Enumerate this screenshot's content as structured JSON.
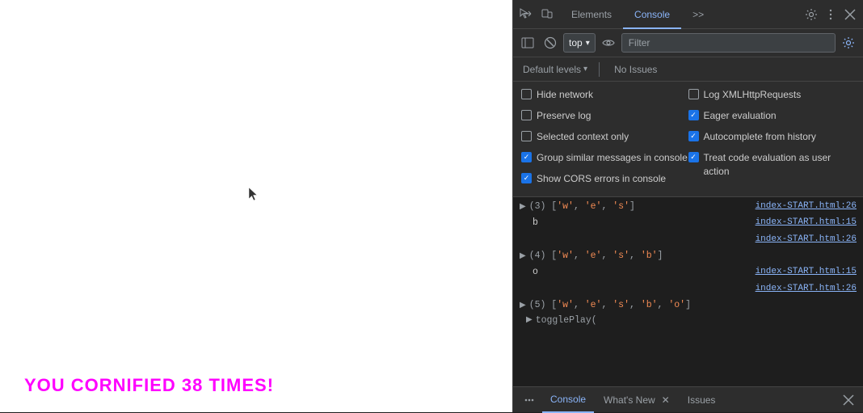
{
  "webpage": {
    "cornified_text": "YOU CORNIFIED 38 TIMES!"
  },
  "devtools": {
    "tabs": [
      {
        "label": "Elements",
        "active": false
      },
      {
        "label": "Console",
        "active": true
      },
      {
        "label": ">>",
        "active": false
      }
    ],
    "top_icons": {
      "cursor_icon": "cursor-icon",
      "device_icon": "device-icon",
      "gear_icon": "gear-icon",
      "more_icon": "more-icon",
      "close_icon": "close-icon"
    },
    "header": {
      "sidebar_icon": "sidebar-icon",
      "clear_icon": "clear-icon",
      "context_label": "top",
      "context_arrow": "▾",
      "eye_icon": "eye-icon",
      "filter_placeholder": "Filter",
      "settings_icon": "settings-icon"
    },
    "subbar": {
      "levels_label": "Default levels",
      "levels_arrow": "▾",
      "no_issues": "No Issues"
    },
    "settings": {
      "col1": [
        {
          "label": "Hide network",
          "checked": false
        },
        {
          "label": "Preserve log",
          "checked": false
        },
        {
          "label": "Selected context only",
          "checked": false
        },
        {
          "label": "Group similar messages in console",
          "checked": true
        },
        {
          "label": "Show CORS errors in console",
          "checked": true
        }
      ],
      "col2": [
        {
          "label": "Log XMLHttpRequests",
          "checked": false
        },
        {
          "label": "Eager evaluation",
          "checked": true
        },
        {
          "label": "Autocomplete from history",
          "checked": true
        },
        {
          "label": "Treat code evaluation as user action",
          "checked": true
        }
      ]
    },
    "console_lines": [
      {
        "type": "expandable",
        "arrow": "▶",
        "content": "(3) [<span class='string-val'>'w'</span>, <span class='string-val'>'e'</span>, <span class='string-val'>'s'</span>]",
        "link": "index-START.html:26"
      },
      {
        "type": "simple",
        "content": "b",
        "link": "index-START.html:15"
      },
      {
        "type": "spacer",
        "link": "index-START.html:26"
      },
      {
        "type": "expandable",
        "arrow": "▶",
        "content": "(4) [<span class='string-val'>'w'</span>, <span class='string-val'>'e'</span>, <span class='string-val'>'s'</span>, <span class='string-val'>'b'</span>]",
        "link": ""
      },
      {
        "type": "simple",
        "content": "o",
        "link": "index-START.html:15"
      },
      {
        "type": "spacer2",
        "link": "index-START.html:26"
      },
      {
        "type": "expandable",
        "arrow": "▶",
        "content": "(5) [<span class='string-val'>'w'</span>, <span class='string-val'>'e'</span>, <span class='string-val'>'s'</span>, <span class='string-val'>'b'</span>, <span class='string-val'>'o'</span>]",
        "link": ""
      },
      {
        "type": "toggle",
        "arrow": "▶",
        "content": "togglePlay(",
        "link": ""
      }
    ],
    "bottom_bar": {
      "tabs": [
        {
          "label": "Console",
          "active": true,
          "closeable": false
        },
        {
          "label": "What's New",
          "active": false,
          "closeable": true
        },
        {
          "label": "Issues",
          "active": false,
          "closeable": false
        }
      ],
      "more_icon": "more-tabs-icon",
      "close_icon": "bottom-close-icon"
    }
  }
}
